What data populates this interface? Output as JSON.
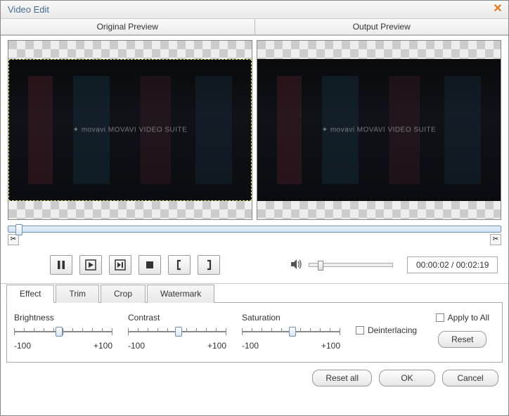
{
  "window": {
    "title": "Video Edit"
  },
  "previews": {
    "left_label": "Original Preview",
    "right_label": "Output Preview",
    "watermark": "✦ movavi  MOVAVI VIDEO SUITE"
  },
  "playback": {
    "time_display": "00:00:02 / 00:02:19"
  },
  "tabs": {
    "effect": "Effect",
    "trim": "Trim",
    "crop": "Crop",
    "watermark": "Watermark"
  },
  "effect": {
    "brightness": {
      "label": "Brightness",
      "min": "-100",
      "max": "+100",
      "pos_pct": 42
    },
    "contrast": {
      "label": "Contrast",
      "min": "-100",
      "max": "+100",
      "pos_pct": 48
    },
    "saturation": {
      "label": "Saturation",
      "min": "-100",
      "max": "+100",
      "pos_pct": 48
    },
    "deinterlacing": "Deinterlacing",
    "apply_all": "Apply to All",
    "reset": "Reset"
  },
  "footer": {
    "reset_all": "Reset all",
    "ok": "OK",
    "cancel": "Cancel"
  }
}
